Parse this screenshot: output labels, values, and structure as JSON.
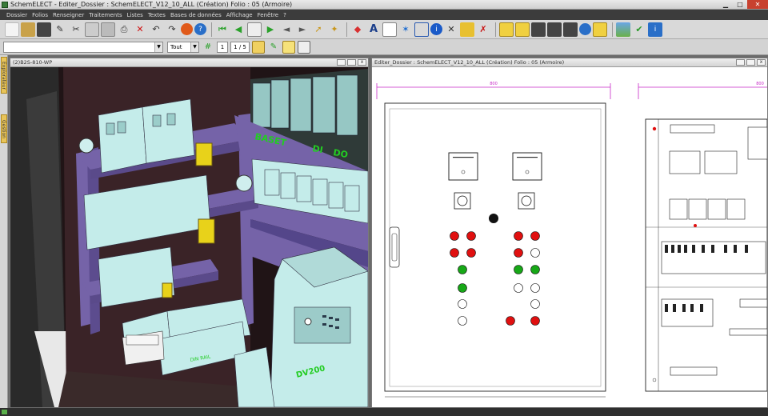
{
  "app": {
    "title": "SchemELECT - Editer_Dossier : SchemELECT_V12_10_ALL  (Création)  Folio : 05  (Armoire)",
    "min": "▁",
    "max": "□",
    "close": "✕"
  },
  "menu": [
    "Dossier",
    "Folios",
    "Renseigner",
    "Traitements",
    "Listes",
    "Textes",
    "Bases de données",
    "Affichage",
    "Fenêtre",
    "?"
  ],
  "toolbar2": {
    "combo_value": "",
    "filter_value": "Tout",
    "page_current": "1",
    "page_total": "1 / 5"
  },
  "dock": {
    "tab1": "Explorateur",
    "tab2": "Gestion"
  },
  "window3d": {
    "title": "(2)B2S-810-WP",
    "labels": {
      "baset": "BASET",
      "di": "DI",
      "do": "DO",
      "variator": "DV200",
      "din_label": "DIN RAIL"
    }
  },
  "window2d": {
    "title": "Editer_Dossier : SchemELECT_V12_10_ALL  (Création)  Folio : 05  (Armoire)",
    "dim1": "800",
    "dim2": "800"
  },
  "colors": {
    "cabinet": "#7563a8",
    "module": "#a8d8d6",
    "label_green": "#22cc22",
    "pilot_red": "#e01010",
    "pilot_green": "#17a817",
    "dimension": "#c82ac8"
  }
}
